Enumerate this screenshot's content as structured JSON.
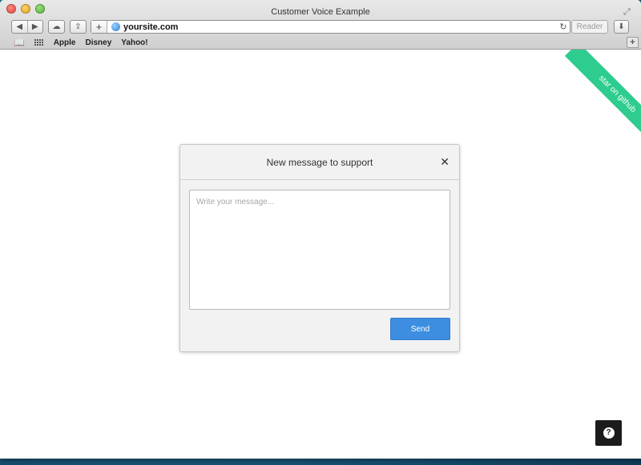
{
  "window": {
    "title": "Customer Voice Example"
  },
  "toolbar": {
    "back_icon": "◀",
    "forward_icon": "▶",
    "cloud_icon": "☁",
    "share_icon": "⇪",
    "add_icon": "+",
    "address": "yoursite.com",
    "reload_icon": "↻",
    "reader_label": "Reader",
    "download_icon": "⬇"
  },
  "bookmarks": {
    "items": [
      "Apple",
      "Disney",
      "Yahoo!"
    ]
  },
  "page": {
    "ribbon_text": "star on github"
  },
  "modal": {
    "title": "New message to support",
    "close_icon": "✕",
    "message_value": "",
    "message_placeholder": "Write your message...",
    "send_label": "Send"
  },
  "help_button": {
    "icon": "?"
  },
  "colors": {
    "accent": "#3d8ee0",
    "ribbon": "#2ecc8f",
    "help_bg": "#1c1c1c"
  }
}
